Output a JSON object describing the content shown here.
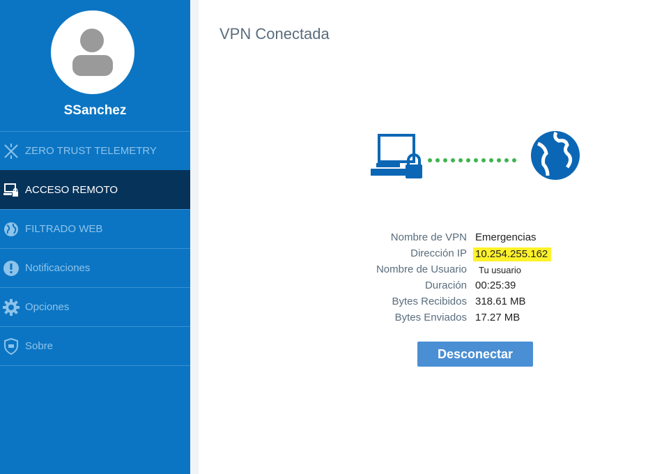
{
  "user": {
    "name": "SSanchez"
  },
  "sidebar": {
    "items": [
      {
        "label": "ZERO TRUST TELEMETRY",
        "icon": "network-icon",
        "active": false
      },
      {
        "label": "ACCESO REMOTO",
        "icon": "remote-access-icon",
        "active": true
      },
      {
        "label": "FILTRADO WEB",
        "icon": "globe-icon",
        "active": false
      },
      {
        "label": "Notificaciones",
        "icon": "alert-icon",
        "active": false
      },
      {
        "label": "Opciones",
        "icon": "gear-icon",
        "active": false
      },
      {
        "label": "Sobre",
        "icon": "shield-icon",
        "active": false
      }
    ]
  },
  "main": {
    "title": "VPN Conectada",
    "details": [
      {
        "label": "Nombre de VPN",
        "value": "Emergencias"
      },
      {
        "label": "Dirección IP",
        "value": "10.254.255.162"
      },
      {
        "label": "Nombre de Usuario",
        "value": "Tu usuario"
      },
      {
        "label": "Duración",
        "value": "00:25:39"
      },
      {
        "label": "Bytes Recibidos",
        "value": "318.61 MB"
      },
      {
        "label": "Bytes Enviados",
        "value": "17.27 MB"
      }
    ],
    "disconnect_label": "Desconectar"
  },
  "colors": {
    "sidebar": "#0b75c3",
    "active_item": "#06335a",
    "connection_dots": "#3fb34f",
    "highlight": "#fff22a",
    "button": "#4a8fd4"
  }
}
